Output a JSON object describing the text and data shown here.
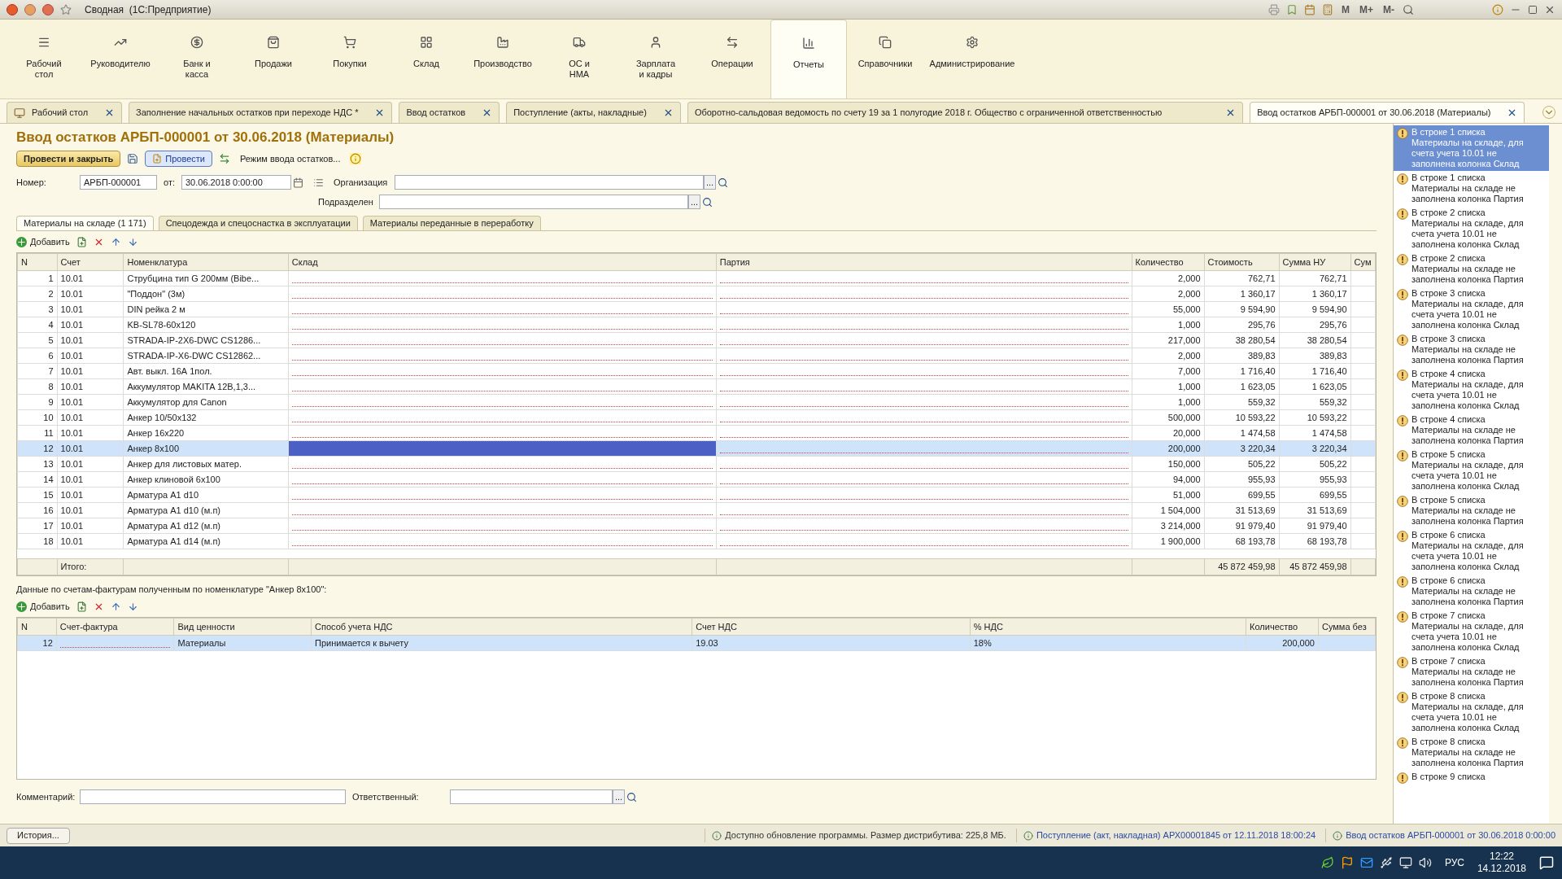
{
  "window": {
    "title": "Сводная  (1С:Предприятие)",
    "memory_buttons": [
      "M",
      "M+",
      "M-"
    ]
  },
  "sections": [
    {
      "label": "Рабочий\nстол",
      "selected": false
    },
    {
      "label": "Руководителю",
      "selected": false
    },
    {
      "label": "Банк и\nкасса",
      "selected": false
    },
    {
      "label": "Продажи",
      "selected": false
    },
    {
      "label": "Покупки",
      "selected": false
    },
    {
      "label": "Склад",
      "selected": false
    },
    {
      "label": "Производство",
      "selected": false
    },
    {
      "label": "ОС и\nНМА",
      "selected": false
    },
    {
      "label": "Зарплата\nи кадры",
      "selected": false
    },
    {
      "label": "Операции",
      "selected": false
    },
    {
      "label": "Отчеты",
      "selected": true
    },
    {
      "label": "Справочники",
      "selected": false
    },
    {
      "label": "Администрирование",
      "selected": false
    }
  ],
  "open_tabs": [
    {
      "label": "Рабочий стол",
      "selected": false
    },
    {
      "label": "Заполнение начальных остатков при переходе НДС *",
      "selected": false
    },
    {
      "label": "Ввод остатков",
      "selected": false
    },
    {
      "label": "Поступление (акты, накладные)",
      "selected": false
    },
    {
      "label": "Оборотно-сальдовая ведомость по счету 19 за 1 полугодие 2018 г. Общество с ограниченной ответственностью",
      "selected": false
    },
    {
      "label": "Ввод остатков АРБП-000001 от 30.06.2018 (Материалы)",
      "selected": true
    }
  ],
  "document": {
    "title": "Ввод остатков АРБП-000001 от 30.06.2018 (Материалы)",
    "post_close_button": "Провести и закрыть",
    "post_button": "Провести",
    "mode_button": "Режим ввода остатков...",
    "number_label": "Номер:",
    "number": "АРБП-000001",
    "date_label": "от:",
    "date": "30.06.2018  0:00:00",
    "organization_label": "Организация",
    "department_label": "Подразделен",
    "select_button": "..."
  },
  "inner_tabs": [
    {
      "label": "Материалы на складе (1 171)",
      "selected": true
    },
    {
      "label": "Спецодежда и спецоснастка в эксплуатации",
      "selected": false
    },
    {
      "label": "Материалы переданные в переработку",
      "selected": false
    }
  ],
  "add_button": "Добавить",
  "invoice_add_button": "Добавить",
  "table": {
    "columns": [
      "N",
      "Счет",
      "Номенклатура",
      "Склад",
      "Партия",
      "Количество",
      "Стоимость",
      "Сумма НУ",
      "Сум"
    ],
    "rows": [
      {
        "n": "1",
        "account": "10.01",
        "item": "Струбцина тип G 200мм (Bibe...",
        "qty": "2,000",
        "cost": "762,71",
        "sum_nu": "762,71",
        "selected": false
      },
      {
        "n": "2",
        "account": "10.01",
        "item": "\"Поддон\" (3м)",
        "qty": "2,000",
        "cost": "1 360,17",
        "sum_nu": "1 360,17",
        "selected": false
      },
      {
        "n": "3",
        "account": "10.01",
        "item": "DIN рейка 2 м",
        "qty": "55,000",
        "cost": "9 594,90",
        "sum_nu": "9 594,90",
        "selected": false
      },
      {
        "n": "4",
        "account": "10.01",
        "item": "KB-SL78-60x120",
        "qty": "1,000",
        "cost": "295,76",
        "sum_nu": "295,76",
        "selected": false
      },
      {
        "n": "5",
        "account": "10.01",
        "item": "STRADA-IP-2X6-DWC CS1286...",
        "qty": "217,000",
        "cost": "38 280,54",
        "sum_nu": "38 280,54",
        "selected": false
      },
      {
        "n": "6",
        "account": "10.01",
        "item": "STRADA-IP-X6-DWC CS12862...",
        "qty": "2,000",
        "cost": "389,83",
        "sum_nu": "389,83",
        "selected": false
      },
      {
        "n": "7",
        "account": "10.01",
        "item": "Авт. выкл. 16А 1пол.",
        "qty": "7,000",
        "cost": "1 716,40",
        "sum_nu": "1 716,40",
        "selected": false
      },
      {
        "n": "8",
        "account": "10.01",
        "item": "Аккумулятор MAKITA 12В,1,3...",
        "qty": "1,000",
        "cost": "1 623,05",
        "sum_nu": "1 623,05",
        "selected": false
      },
      {
        "n": "9",
        "account": "10.01",
        "item": "Аккумулятор для Canon",
        "qty": "1,000",
        "cost": "559,32",
        "sum_nu": "559,32",
        "selected": false
      },
      {
        "n": "10",
        "account": "10.01",
        "item": "Анкер 10/50х132",
        "qty": "500,000",
        "cost": "10 593,22",
        "sum_nu": "10 593,22",
        "selected": false
      },
      {
        "n": "11",
        "account": "10.01",
        "item": "Анкер 16х220",
        "qty": "20,000",
        "cost": "1 474,58",
        "sum_nu": "1 474,58",
        "selected": false
      },
      {
        "n": "12",
        "account": "10.01",
        "item": "Анкер 8х100",
        "qty": "200,000",
        "cost": "3 220,34",
        "sum_nu": "3 220,34",
        "selected": true
      },
      {
        "n": "13",
        "account": "10.01",
        "item": "Анкер для листовых матер.",
        "qty": "150,000",
        "cost": "505,22",
        "sum_nu": "505,22",
        "selected": false
      },
      {
        "n": "14",
        "account": "10.01",
        "item": "Анкер клиновой 6х100",
        "qty": "94,000",
        "cost": "955,93",
        "sum_nu": "955,93",
        "selected": false
      },
      {
        "n": "15",
        "account": "10.01",
        "item": "Арматура А1  d10",
        "qty": "51,000",
        "cost": "699,55",
        "sum_nu": "699,55",
        "selected": false
      },
      {
        "n": "16",
        "account": "10.01",
        "item": "Арматура А1  d10 (м.п)",
        "qty": "1 504,000",
        "cost": "31 513,69",
        "sum_nu": "31 513,69",
        "selected": false
      },
      {
        "n": "17",
        "account": "10.01",
        "item": "Арматура А1 d12 (м.п)",
        "qty": "3 214,000",
        "cost": "91 979,40",
        "sum_nu": "91 979,40",
        "selected": false
      },
      {
        "n": "18",
        "account": "10.01",
        "item": "Арматура А1 d14 (м.п)",
        "qty": "1 900,000",
        "cost": "68 193,78",
        "sum_nu": "68 193,78",
        "selected": false
      }
    ],
    "totals": {
      "label": "Итого:",
      "cost": "45 872 459,98",
      "sum_nu": "45 872 459,98"
    }
  },
  "invoice_caption": "Данные по счетам-фактурам полученным по номенклатуре \"Анкер 8х100\":",
  "invoice_table": {
    "columns": [
      "N",
      "Счет-фактура",
      "Вид ценности",
      "Способ учета НДС",
      "Счет НДС",
      "% НДС",
      "Количество",
      "Сумма без"
    ],
    "rows": [
      {
        "n": "12",
        "value_type": "Материалы",
        "vat_method": "Принимается к вычету",
        "vat_account": "19.03",
        "vat_rate": "18%",
        "qty": "200,000",
        "selected": true
      }
    ]
  },
  "comment_label": "Комментарий:",
  "responsible_label": "Ответственный:",
  "messages": [
    {
      "text": "В строке 1 списка Материалы на складе, для счета учета 10.01 не заполнена колонка Склад",
      "selected": true
    },
    {
      "text": "В строке 1 списка Материалы на складе не заполнена колонка Партия",
      "selected": false
    },
    {
      "text": "В строке 2 списка Материалы на складе, для счета учета 10.01 не заполнена колонка Склад",
      "selected": false
    },
    {
      "text": "В строке 2 списка Материалы на складе не заполнена колонка Партия",
      "selected": false
    },
    {
      "text": "В строке 3 списка Материалы на складе, для счета учета 10.01 не заполнена колонка Склад",
      "selected": false
    },
    {
      "text": "В строке 3 списка Материалы на складе не заполнена колонка Партия",
      "selected": false
    },
    {
      "text": "В строке 4 списка Материалы на складе, для счета учета 10.01 не заполнена колонка Склад",
      "selected": false
    },
    {
      "text": "В строке 4 списка Материалы на складе не заполнена колонка Партия",
      "selected": false
    },
    {
      "text": "В строке 5 списка Материалы на складе, для счета учета 10.01 не заполнена колонка Склад",
      "selected": false
    },
    {
      "text": "В строке 5 списка Материалы на складе не заполнена колонка Партия",
      "selected": false
    },
    {
      "text": "В строке 6 списка Материалы на складе, для счета учета 10.01 не заполнена колонка Склад",
      "selected": false
    },
    {
      "text": "В строке 6 списка Материалы на складе не заполнена колонка Партия",
      "selected": false
    },
    {
      "text": "В строке 7 списка Материалы на складе, для счета учета 10.01 не заполнена колонка Склад",
      "selected": false
    },
    {
      "text": "В строке 7 списка Материалы на складе не заполнена колонка Партия",
      "selected": false
    },
    {
      "text": "В строке 8 списка Материалы на складе, для счета учета 10.01 не заполнена колонка Склад",
      "selected": false
    },
    {
      "text": "В строке 8 списка Материалы на складе не заполнена колонка Партия",
      "selected": false
    },
    {
      "text": "В строке 9 списка",
      "selected": false
    }
  ],
  "status_bar": {
    "history_button": "История...",
    "notices": [
      "Доступно обновление программы. Размер дистрибутива: 225,8 МБ.",
      "Поступление (акт, накладная) АРХ00001845 от 12.11.2018 18:00:24",
      "Ввод остатков АРБП-000001 от 30.06.2018 0:00:00"
    ]
  },
  "taskbar": {
    "language": "РУС",
    "time": "12:22",
    "date": "14.12.2018"
  }
}
